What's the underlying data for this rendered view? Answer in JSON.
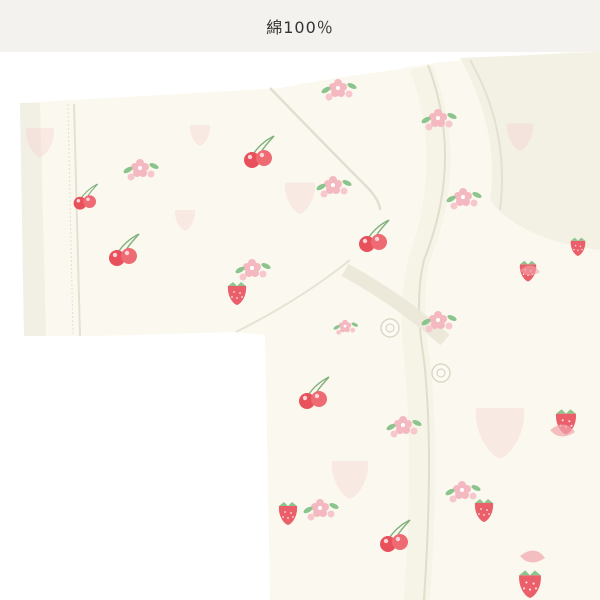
{
  "label": {
    "text": "綿100％"
  },
  "photo": {
    "subject_icon": "baby-garment-photo",
    "colors": {
      "fabric": "#fbf9ef",
      "fabric_shadow": "#efeee2",
      "stitch": "#d9d6c8",
      "cherry": "#e8505b",
      "cherry_light": "#f39aa0",
      "strawberry": "#ea5f6a",
      "strawberry_faint": "#f7c9cc",
      "blossom": "#f4b9c0",
      "leaf": "#8cc48d",
      "button": "#fbfaf3"
    }
  }
}
